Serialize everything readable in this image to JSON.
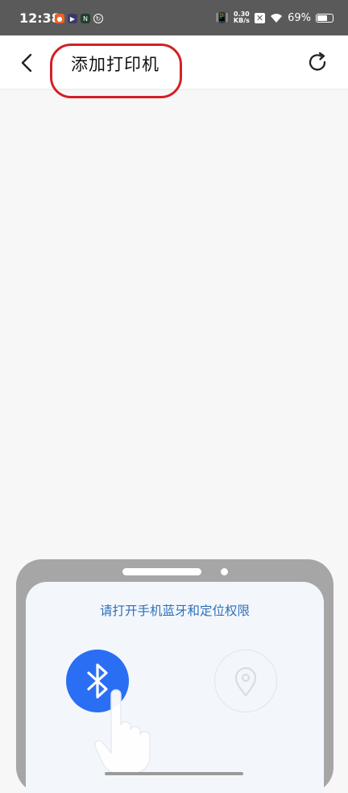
{
  "status_bar": {
    "time": "12:38",
    "speed_value": "0.30",
    "speed_unit": "KB/s",
    "battery_percent": "69%",
    "battery_level": 0.69,
    "icons": [
      "notification-app-icon",
      "video-app-icon",
      "n-app-icon",
      "sync-app-icon",
      "vibrate-icon",
      "sim-off-icon",
      "wifi-icon",
      "battery-icon"
    ]
  },
  "header": {
    "title": "添加打印机",
    "back_icon": "chevron-left-icon",
    "refresh_icon": "refresh-icon",
    "highlight_color": "#d32027"
  },
  "illustration": {
    "permission_text": "请打开手机蓝牙和定位权限",
    "bluetooth_icon": "bluetooth-icon",
    "location_icon": "location-pin-icon",
    "hand_icon": "pointing-hand-icon",
    "accent_color": "#2a6ff3"
  }
}
